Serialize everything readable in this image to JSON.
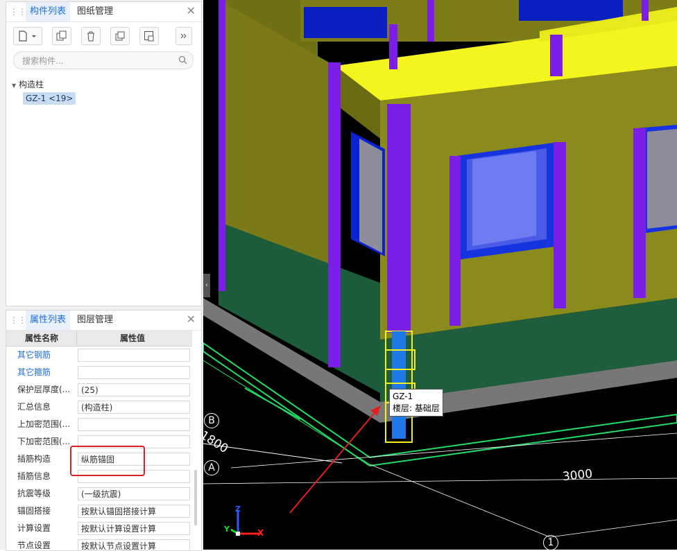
{
  "component_panel": {
    "tabs": [
      "构件列表",
      "图纸管理"
    ],
    "search_placeholder": "搜索构件...",
    "tree": {
      "root": "构造柱",
      "items": [
        "GZ-1 <19>"
      ]
    }
  },
  "property_panel": {
    "tabs": [
      "属性列表",
      "图层管理"
    ],
    "headers": [
      "属性名称",
      "属性值"
    ],
    "rows": [
      {
        "name": "其它钢筋",
        "value": ""
      },
      {
        "name": "其它箍筋",
        "value": ""
      },
      {
        "name": "保护层厚度(...",
        "value": "(25)"
      },
      {
        "name": "汇总信息",
        "value": "(构造柱)"
      },
      {
        "name": "上加密范围(...",
        "value": ""
      },
      {
        "name": "下加密范围(...",
        "value": ""
      },
      {
        "name": "插筋构造",
        "value": "纵筋锚固"
      },
      {
        "name": "插筋信息",
        "value": ""
      },
      {
        "name": "抗震等级",
        "value": "(一级抗震)"
      },
      {
        "name": "锚固搭接",
        "value": "按默认锚固搭接计算"
      },
      {
        "name": "计算设置",
        "value": "按默认计算设置计算"
      },
      {
        "name": "节点设置",
        "value": "按默认节点设置计算"
      }
    ]
  },
  "viewport": {
    "tooltip": {
      "name": "GZ-1",
      "floor": "楼层: 基础层"
    },
    "dimensions": [
      "3000",
      "1800"
    ],
    "axis_labels": [
      "B",
      "A",
      "1"
    ],
    "gizmo": {
      "x": "X",
      "y": "Y",
      "z": "Z"
    }
  },
  "colors": {
    "accent": "#1e6fd9",
    "highlight": "#e02020"
  }
}
